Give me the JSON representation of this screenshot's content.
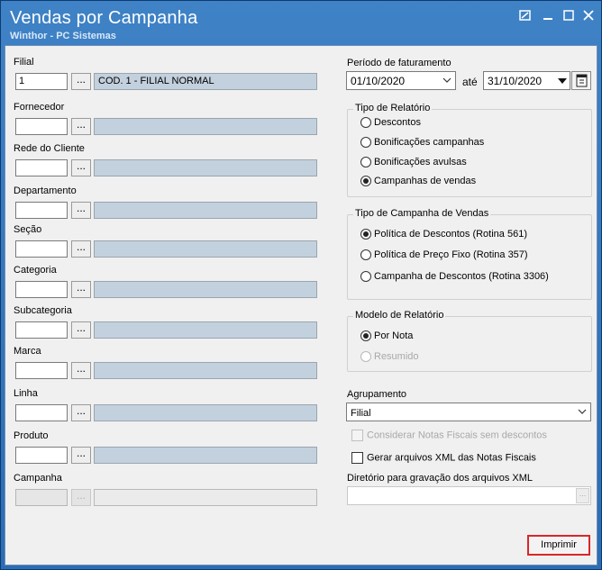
{
  "window": {
    "title": "Vendas por Campanha",
    "subtitle": "Winthor - PC Sistemas"
  },
  "filters": [
    {
      "label": "Filial",
      "code": "1",
      "description": "COD. 1 - FILIAL NORMAL",
      "enabled": true
    },
    {
      "label": "Fornecedor",
      "code": "",
      "description": "",
      "enabled": true
    },
    {
      "label": "Rede do Cliente",
      "code": "",
      "description": "",
      "enabled": true
    },
    {
      "label": "Departamento",
      "code": "",
      "description": "",
      "enabled": true
    },
    {
      "label": "Seção",
      "code": "",
      "description": "",
      "enabled": true
    },
    {
      "label": "Categoria",
      "code": "",
      "description": "",
      "enabled": true
    },
    {
      "label": "Subcategoria",
      "code": "",
      "description": "",
      "enabled": true
    },
    {
      "label": "Marca",
      "code": "",
      "description": "",
      "enabled": true
    },
    {
      "label": "Linha",
      "code": "",
      "description": "",
      "enabled": true
    },
    {
      "label": "Produto",
      "code": "",
      "description": "",
      "enabled": true
    },
    {
      "label": "Campanha",
      "code": "",
      "description": "",
      "enabled": false
    }
  ],
  "lookup_button_label": "...",
  "periodo": {
    "label": "Período de faturamento",
    "start": "01/10/2020",
    "separator": "até",
    "end": "31/10/2020"
  },
  "tipo_relatorio": {
    "title": "Tipo de Relatório",
    "options": [
      {
        "label": "Descontos",
        "selected": false
      },
      {
        "label": "Bonificações campanhas",
        "selected": false
      },
      {
        "label": "Bonificações avulsas",
        "selected": false
      },
      {
        "label": "Campanhas de vendas",
        "selected": true
      }
    ]
  },
  "tipo_campanha": {
    "title": "Tipo de Campanha de Vendas",
    "options": [
      {
        "label": "Política de Descontos (Rotina 561)",
        "selected": true
      },
      {
        "label": "Política de Preço Fixo (Rotina 357)",
        "selected": false
      },
      {
        "label": "Campanha de Descontos (Rotina 3306)",
        "selected": false
      }
    ]
  },
  "modelo_relatorio": {
    "title": "Modelo de Relatório",
    "options": [
      {
        "label": "Por Nota",
        "selected": true,
        "enabled": true
      },
      {
        "label": "Resumido",
        "selected": false,
        "enabled": false
      }
    ]
  },
  "agrupamento": {
    "label": "Agrupamento",
    "value": "Filial"
  },
  "checkboxes": {
    "considerar": {
      "label": "Considerar Notas Fiscais sem descontos",
      "checked": false,
      "enabled": false
    },
    "gerar_xml": {
      "label": "Gerar arquivos XML das Notas Fiscais",
      "checked": false,
      "enabled": true
    }
  },
  "diretorio": {
    "label": "Diretório para gravação dos arquivos XML",
    "value": ""
  },
  "actions": {
    "print_label": "Imprimir"
  }
}
